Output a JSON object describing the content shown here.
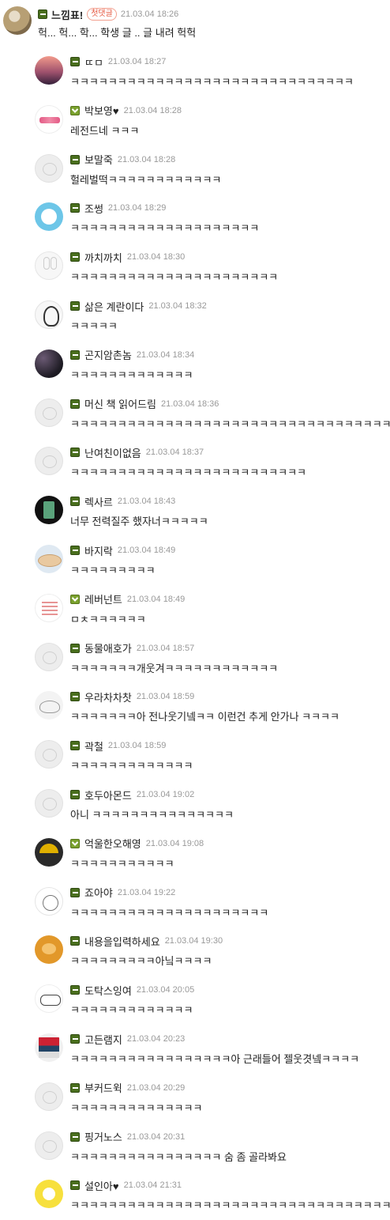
{
  "top_comment": {
    "nickname": "느낌표!",
    "badge": "첫댓글",
    "time": "21.03.04 18:26",
    "text": "헉... 헉... 학... 학생 글 .. 글 내려 헉헉"
  },
  "replies": [
    {
      "nickname": "ㄸㅁ",
      "time": "21.03.04 18:27",
      "text": "ㅋㅋㅋㅋㅋㅋㅋㅋㅋㅋㅋㅋㅋㅋㅋㅋㅋㅋㅋㅋㅋㅋㅋㅋㅋㅋㅋㅋㅋㅋ",
      "level": "bar",
      "avatar": "sunset"
    },
    {
      "nickname": "박보영♥",
      "time": "21.03.04 18:28",
      "text": "레전드네 ㅋㅋㅋ",
      "level": "chev",
      "avatar": "pink"
    },
    {
      "nickname": "보말죽",
      "time": "21.03.04 18:28",
      "text": "헐레벌떡ㅋㅋㅋㅋㅋㅋㅋㅋㅋㅋㅋㅋ",
      "level": "bar",
      "avatar": "generic"
    },
    {
      "nickname": "조썽",
      "time": "21.03.04 18:29",
      "text": "ㅋㅋㅋㅋㅋㅋㅋㅋㅋㅋㅋㅋㅋㅋㅋㅋㅋㅋㅋㅋ",
      "level": "bar",
      "avatar": "blue"
    },
    {
      "nickname": "까치까치",
      "time": "21.03.04 18:30",
      "text": "ㅋㅋㅋㅋㅋㅋㅋㅋㅋㅋㅋㅋㅋㅋㅋㅋㅋㅋㅋㅋㅋㅋ",
      "level": "bar",
      "avatar": "rabbit"
    },
    {
      "nickname": "삶은 계란이다",
      "time": "21.03.04 18:32",
      "text": "ㅋㅋㅋㅋㅋ",
      "level": "bar",
      "avatar": "penguin"
    },
    {
      "nickname": "곤지암촌놈",
      "time": "21.03.04 18:34",
      "text": "ㅋㅋㅋㅋㅋㅋㅋㅋㅋㅋㅋㅋㅋ",
      "level": "bar",
      "avatar": "dark"
    },
    {
      "nickname": "머신 책 읽어드림",
      "time": "21.03.04 18:36",
      "text": "ㅋㅋㅋㅋㅋㅋㅋㅋㅋㅋㅋㅋㅋㅋㅋㅋㅋㅋㅋㅋㅋㅋㅋㅋㅋㅋㅋㅋㅋㅋㅋㅋㅋㅋ",
      "level": "bar",
      "avatar": "generic"
    },
    {
      "nickname": "난여친이없음",
      "time": "21.03.04 18:37",
      "text": "ㅋㅋㅋㅋㅋㅋㅋㅋㅋㅋㅋㅋㅋㅋㅋㅋㅋㅋㅋㅋㅋㅋㅋㅋㅋ",
      "level": "bar",
      "avatar": "generic"
    },
    {
      "nickname": "렉사르",
      "time": "21.03.04 18:43",
      "text": "너무 전력질주 했자너ㅋㅋㅋㅋㅋ",
      "level": "bar",
      "avatar": "green"
    },
    {
      "nickname": "바지락",
      "time": "21.03.04 18:49",
      "text": "ㅋㅋㅋㅋㅋㅋㅋㅋㅋ",
      "level": "bar",
      "avatar": "wave"
    },
    {
      "nickname": "레버넌트",
      "time": "21.03.04 18:49",
      "text": "ㅁㅊㅋㅋㅋㅋㅋㅋ",
      "level": "chev",
      "avatar": "list"
    },
    {
      "nickname": "동물애호가",
      "time": "21.03.04 18:57",
      "text": "ㅋㅋㅋㅋㅋㅋㅋ개웃겨ㅋㅋㅋㅋㅋㅋㅋㅋㅋㅋㅋㅋ",
      "level": "bar",
      "avatar": "generic"
    },
    {
      "nickname": "우라차차찻",
      "time": "21.03.04 18:59",
      "text": "ㅋㅋㅋㅋㅋㅋㅋ아 전나웃기넼ㅋㅋ 이런건 추게 안가나 ㅋㅋㅋㅋ",
      "level": "bar",
      "avatar": "dino"
    },
    {
      "nickname": "곽철",
      "time": "21.03.04 18:59",
      "text": "ㅋㅋㅋㅋㅋㅋㅋㅋㅋㅋㅋㅋㅋ",
      "level": "bar",
      "avatar": "generic"
    },
    {
      "nickname": "호두아몬드",
      "time": "21.03.04 19:02",
      "text": "아니 ㅋㅋㅋㅋㅋㅋㅋㅋㅋㅋㅋㅋㅋㅋㅋ",
      "level": "bar",
      "avatar": "generic"
    },
    {
      "nickname": "억울한오해영",
      "time": "21.03.04 19:08",
      "text": "ㅋㅋㅋㅋㅋㅋㅋㅋㅋㅋㅋ",
      "level": "chev",
      "avatar": "umbrella"
    },
    {
      "nickname": "죠아야",
      "time": "21.03.04 19:22",
      "text": "ㅋㅋㅋㅋㅋㅋㅋㅋㅋㅋㅋㅋㅋㅋㅋㅋㅋㅋㅋㅋㅋ",
      "level": "bar",
      "avatar": "face"
    },
    {
      "nickname": "내용을입력하세요",
      "time": "21.03.04 19:30",
      "text": "ㅋㅋㅋㅋㅋㅋㅋㅋㅋ아닠ㅋㅋㅋㅋ",
      "level": "bar",
      "avatar": "ryan"
    },
    {
      "nickname": "도탁스잉여",
      "time": "21.03.04 20:05",
      "text": "ㅋㅋㅋㅋㅋㅋㅋㅋㅋㅋㅋㅋㅋ",
      "level": "bar",
      "avatar": "doodle"
    },
    {
      "nickname": "고든램지",
      "time": "21.03.04 20:23",
      "text": "ㅋㅋㅋㅋㅋㅋㅋㅋㅋㅋㅋㅋㅋㅋㅋㅋㅋ아 근래들어 젤웃겻넼ㅋㅋㅋㅋ",
      "level": "bar",
      "avatar": "poster"
    },
    {
      "nickname": "부커드윅",
      "time": "21.03.04 20:29",
      "text": "ㅋㅋㅋㅋㅋㅋㅋㅋㅋㅋㅋㅋㅋㅋ",
      "level": "bar",
      "avatar": "generic"
    },
    {
      "nickname": "핑거노스",
      "time": "21.03.04 20:31",
      "text": "ㅋㅋㅋㅋㅋㅋㅋㅋㅋㅋㅋㅋㅋㅋㅋㅋ 숨 좀 골라봐요",
      "level": "bar",
      "avatar": "generic"
    },
    {
      "nickname": "설인아♥",
      "time": "21.03.04 21:31",
      "text": "ㅋㅋㅋㅋㅋㅋㅋㅋㅋㅋㅋㅋㅋㅋㅋㅋㅋㅋㅋㅋㅋㅋㅋㅋㅋㅋㅋㅋㅋㅋㅋㅋㅋㅋ",
      "level": "bar",
      "avatar": "yellow"
    }
  ]
}
